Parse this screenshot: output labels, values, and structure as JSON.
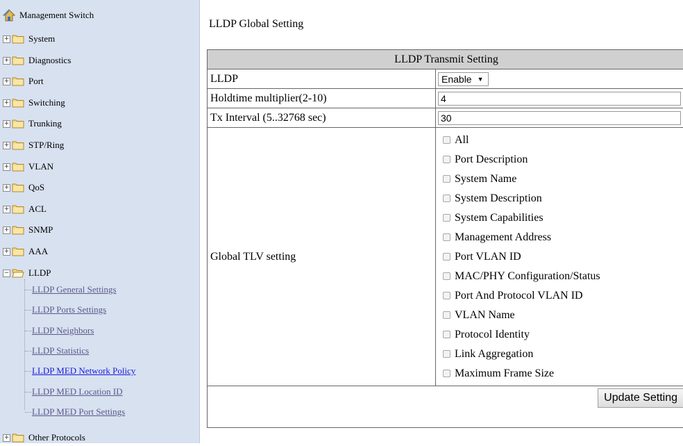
{
  "sidebar": {
    "root": "Management Switch",
    "items": [
      {
        "label": "System",
        "expander": "+"
      },
      {
        "label": "Diagnostics",
        "expander": "+"
      },
      {
        "label": "Port",
        "expander": "+"
      },
      {
        "label": "Switching",
        "expander": "+"
      },
      {
        "label": "Trunking",
        "expander": "+"
      },
      {
        "label": "STP/Ring",
        "expander": "+"
      },
      {
        "label": "VLAN",
        "expander": "+"
      },
      {
        "label": "QoS",
        "expander": "+"
      },
      {
        "label": "ACL",
        "expander": "+"
      },
      {
        "label": "SNMP",
        "expander": "+"
      },
      {
        "label": "AAA",
        "expander": "+"
      },
      {
        "label": "LLDP",
        "expander": "−"
      }
    ],
    "lldp_children": [
      "LLDP General Settings",
      "LLDP Ports Settings",
      "LLDP Neighbors",
      "LLDP Statistics",
      "LLDP MED Network Policy",
      "LLDP MED Location ID",
      "LLDP MED Port Settings"
    ],
    "last_item": {
      "label": "Other Protocols",
      "expander": "+"
    }
  },
  "main": {
    "title": "LLDP Global Setting",
    "table_header": "LLDP Transmit Setting",
    "lldp_label": "LLDP",
    "lldp_value": "Enable",
    "holdtime_label": "Holdtime multiplier(2-10)",
    "holdtime_value": "4",
    "tx_label": "Tx Interval (5..32768 sec)",
    "tx_value": "30",
    "tlv_label": "Global TLV setting",
    "tlv_options": [
      "All",
      "Port Description",
      "System Name",
      "System Description",
      "System Capabilities",
      "Management Address",
      "Port VLAN ID",
      "MAC/PHY Configuration/Status",
      "Port And Protocol VLAN ID",
      "VLAN Name",
      "Protocol Identity",
      "Link Aggregation",
      "Maximum Frame Size"
    ],
    "update_button": "Update Setting"
  },
  "colors": {
    "sidebar_bg": "#d8e1f0",
    "header_bg": "#d0d0d0",
    "link": "#5a5a8a",
    "link_active": "#1a1adf"
  }
}
